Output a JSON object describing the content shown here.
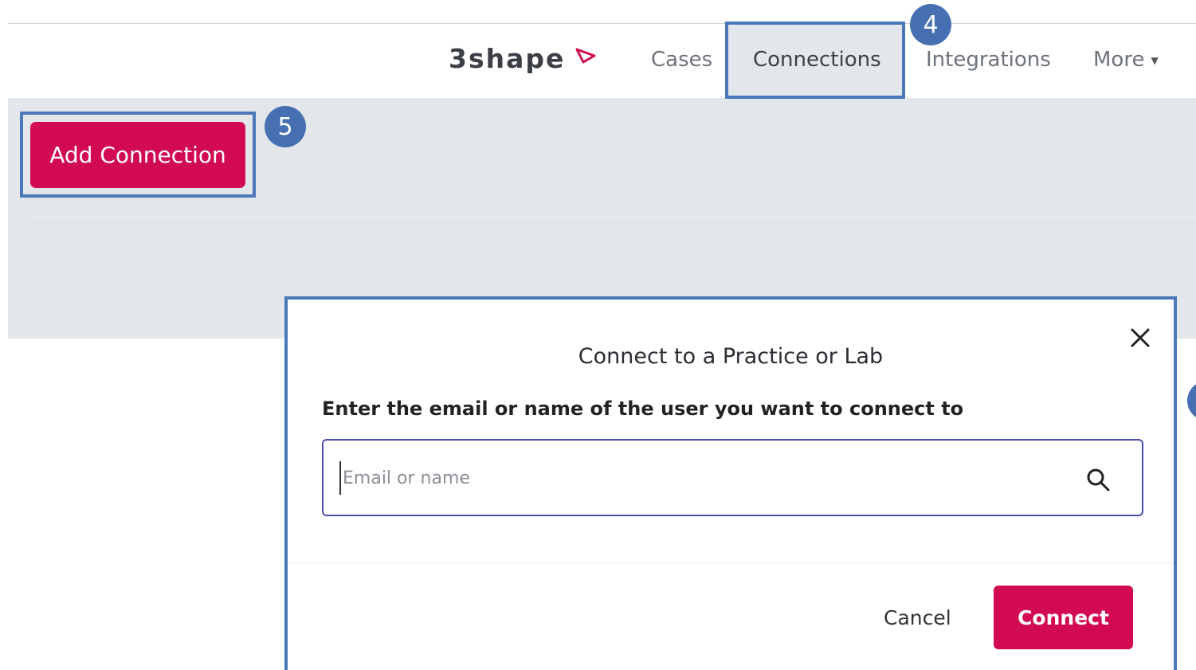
{
  "brand": {
    "name": "3shape",
    "accent_color": "#d10a52"
  },
  "nav": {
    "items": [
      {
        "label": "Cases"
      },
      {
        "label": "Connections",
        "active": true
      },
      {
        "label": "Integrations"
      },
      {
        "label": "More"
      }
    ]
  },
  "toolbar": {
    "add_connection_label": "Add Connection"
  },
  "annotations": {
    "step4": "4",
    "step5": "5",
    "step6": ""
  },
  "modal": {
    "title": "Connect to a Practice or Lab",
    "label": "Enter the email or name of the user you want to connect to",
    "search": {
      "placeholder": "Email or name",
      "value": ""
    },
    "cancel_label": "Cancel",
    "connect_label": "Connect",
    "close_icon": "close-icon",
    "search_icon": "search-icon"
  },
  "colors": {
    "highlight": "#4a78b8",
    "badge": "#4670b2",
    "gray_bg": "#e3e6ea"
  }
}
